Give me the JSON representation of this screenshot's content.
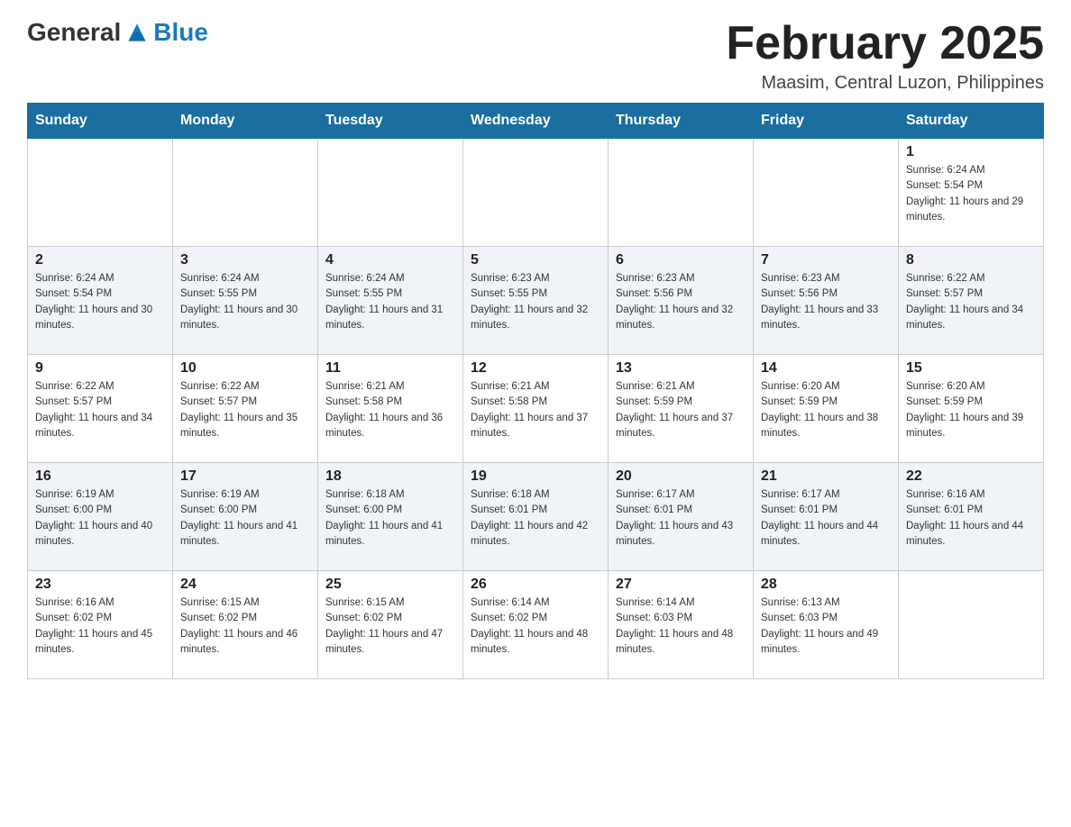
{
  "logo": {
    "text_general": "General",
    "text_blue": "Blue"
  },
  "header": {
    "month_year": "February 2025",
    "location": "Maasim, Central Luzon, Philippines"
  },
  "days_of_week": [
    "Sunday",
    "Monday",
    "Tuesday",
    "Wednesday",
    "Thursday",
    "Friday",
    "Saturday"
  ],
  "weeks": [
    [
      null,
      null,
      null,
      null,
      null,
      null,
      {
        "day": "1",
        "sunrise": "Sunrise: 6:24 AM",
        "sunset": "Sunset: 5:54 PM",
        "daylight": "Daylight: 11 hours and 29 minutes."
      }
    ],
    [
      {
        "day": "2",
        "sunrise": "Sunrise: 6:24 AM",
        "sunset": "Sunset: 5:54 PM",
        "daylight": "Daylight: 11 hours and 30 minutes."
      },
      {
        "day": "3",
        "sunrise": "Sunrise: 6:24 AM",
        "sunset": "Sunset: 5:55 PM",
        "daylight": "Daylight: 11 hours and 30 minutes."
      },
      {
        "day": "4",
        "sunrise": "Sunrise: 6:24 AM",
        "sunset": "Sunset: 5:55 PM",
        "daylight": "Daylight: 11 hours and 31 minutes."
      },
      {
        "day": "5",
        "sunrise": "Sunrise: 6:23 AM",
        "sunset": "Sunset: 5:55 PM",
        "daylight": "Daylight: 11 hours and 32 minutes."
      },
      {
        "day": "6",
        "sunrise": "Sunrise: 6:23 AM",
        "sunset": "Sunset: 5:56 PM",
        "daylight": "Daylight: 11 hours and 32 minutes."
      },
      {
        "day": "7",
        "sunrise": "Sunrise: 6:23 AM",
        "sunset": "Sunset: 5:56 PM",
        "daylight": "Daylight: 11 hours and 33 minutes."
      },
      {
        "day": "8",
        "sunrise": "Sunrise: 6:22 AM",
        "sunset": "Sunset: 5:57 PM",
        "daylight": "Daylight: 11 hours and 34 minutes."
      }
    ],
    [
      {
        "day": "9",
        "sunrise": "Sunrise: 6:22 AM",
        "sunset": "Sunset: 5:57 PM",
        "daylight": "Daylight: 11 hours and 34 minutes."
      },
      {
        "day": "10",
        "sunrise": "Sunrise: 6:22 AM",
        "sunset": "Sunset: 5:57 PM",
        "daylight": "Daylight: 11 hours and 35 minutes."
      },
      {
        "day": "11",
        "sunrise": "Sunrise: 6:21 AM",
        "sunset": "Sunset: 5:58 PM",
        "daylight": "Daylight: 11 hours and 36 minutes."
      },
      {
        "day": "12",
        "sunrise": "Sunrise: 6:21 AM",
        "sunset": "Sunset: 5:58 PM",
        "daylight": "Daylight: 11 hours and 37 minutes."
      },
      {
        "day": "13",
        "sunrise": "Sunrise: 6:21 AM",
        "sunset": "Sunset: 5:59 PM",
        "daylight": "Daylight: 11 hours and 37 minutes."
      },
      {
        "day": "14",
        "sunrise": "Sunrise: 6:20 AM",
        "sunset": "Sunset: 5:59 PM",
        "daylight": "Daylight: 11 hours and 38 minutes."
      },
      {
        "day": "15",
        "sunrise": "Sunrise: 6:20 AM",
        "sunset": "Sunset: 5:59 PM",
        "daylight": "Daylight: 11 hours and 39 minutes."
      }
    ],
    [
      {
        "day": "16",
        "sunrise": "Sunrise: 6:19 AM",
        "sunset": "Sunset: 6:00 PM",
        "daylight": "Daylight: 11 hours and 40 minutes."
      },
      {
        "day": "17",
        "sunrise": "Sunrise: 6:19 AM",
        "sunset": "Sunset: 6:00 PM",
        "daylight": "Daylight: 11 hours and 41 minutes."
      },
      {
        "day": "18",
        "sunrise": "Sunrise: 6:18 AM",
        "sunset": "Sunset: 6:00 PM",
        "daylight": "Daylight: 11 hours and 41 minutes."
      },
      {
        "day": "19",
        "sunrise": "Sunrise: 6:18 AM",
        "sunset": "Sunset: 6:01 PM",
        "daylight": "Daylight: 11 hours and 42 minutes."
      },
      {
        "day": "20",
        "sunrise": "Sunrise: 6:17 AM",
        "sunset": "Sunset: 6:01 PM",
        "daylight": "Daylight: 11 hours and 43 minutes."
      },
      {
        "day": "21",
        "sunrise": "Sunrise: 6:17 AM",
        "sunset": "Sunset: 6:01 PM",
        "daylight": "Daylight: 11 hours and 44 minutes."
      },
      {
        "day": "22",
        "sunrise": "Sunrise: 6:16 AM",
        "sunset": "Sunset: 6:01 PM",
        "daylight": "Daylight: 11 hours and 44 minutes."
      }
    ],
    [
      {
        "day": "23",
        "sunrise": "Sunrise: 6:16 AM",
        "sunset": "Sunset: 6:02 PM",
        "daylight": "Daylight: 11 hours and 45 minutes."
      },
      {
        "day": "24",
        "sunrise": "Sunrise: 6:15 AM",
        "sunset": "Sunset: 6:02 PM",
        "daylight": "Daylight: 11 hours and 46 minutes."
      },
      {
        "day": "25",
        "sunrise": "Sunrise: 6:15 AM",
        "sunset": "Sunset: 6:02 PM",
        "daylight": "Daylight: 11 hours and 47 minutes."
      },
      {
        "day": "26",
        "sunrise": "Sunrise: 6:14 AM",
        "sunset": "Sunset: 6:02 PM",
        "daylight": "Daylight: 11 hours and 48 minutes."
      },
      {
        "day": "27",
        "sunrise": "Sunrise: 6:14 AM",
        "sunset": "Sunset: 6:03 PM",
        "daylight": "Daylight: 11 hours and 48 minutes."
      },
      {
        "day": "28",
        "sunrise": "Sunrise: 6:13 AM",
        "sunset": "Sunset: 6:03 PM",
        "daylight": "Daylight: 11 hours and 49 minutes."
      },
      null
    ]
  ]
}
